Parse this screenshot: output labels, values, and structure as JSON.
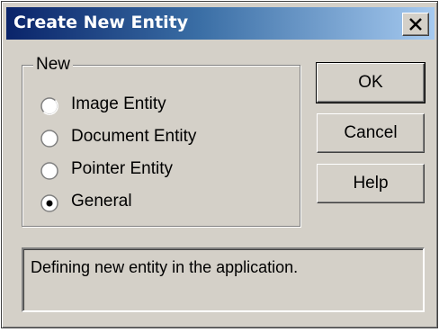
{
  "window": {
    "title": "Create New Entity"
  },
  "group": {
    "legend": "New",
    "options": [
      {
        "label": "Image Entity",
        "selected": false
      },
      {
        "label": "Document Entity",
        "selected": false
      },
      {
        "label": "Pointer Entity",
        "selected": false
      },
      {
        "label": "General",
        "selected": true
      }
    ]
  },
  "buttons": {
    "ok": "OK",
    "cancel": "Cancel",
    "help": "Help"
  },
  "status": {
    "message": "Defining new entity in the application."
  },
  "colors": {
    "titlebar_start": "#0a246a",
    "titlebar_end": "#a6caf0",
    "face": "#d4d0c8"
  }
}
